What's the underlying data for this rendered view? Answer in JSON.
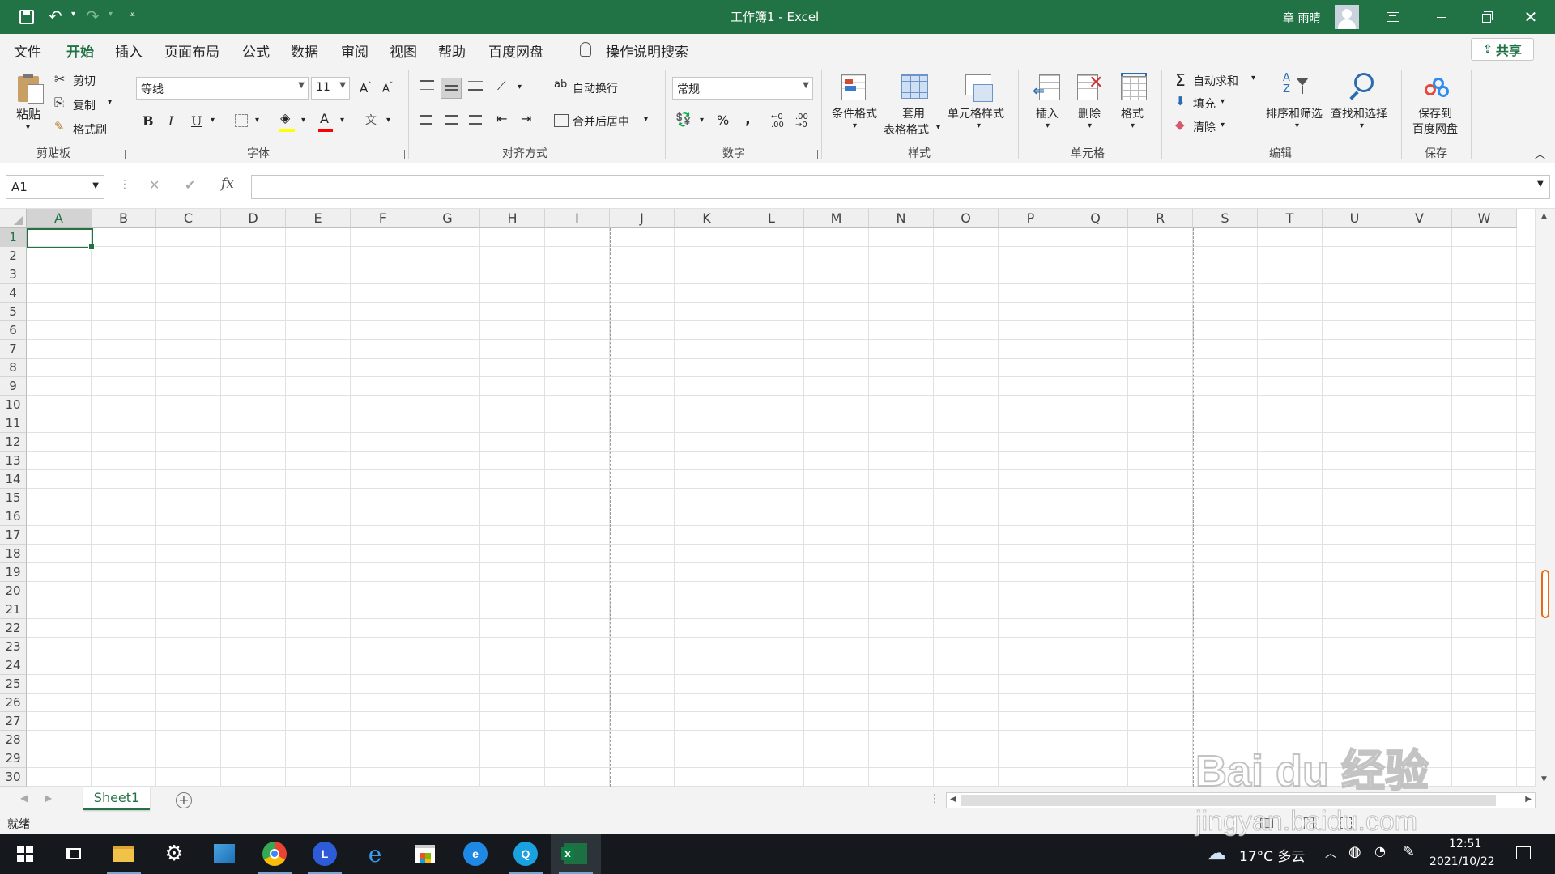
{
  "title_bar": {
    "title": "工作簿1  -  Excel",
    "user": "章 雨晴"
  },
  "menu": {
    "tabs": [
      "文件",
      "开始",
      "插入",
      "页面布局",
      "公式",
      "数据",
      "审阅",
      "视图",
      "帮助",
      "百度网盘"
    ],
    "search": "操作说明搜索",
    "share": "共享"
  },
  "ribbon": {
    "clipboard": {
      "paste": "粘贴",
      "cut": "剪切",
      "copy": "复制",
      "format_painter": "格式刷",
      "label": "剪贴板"
    },
    "font": {
      "name": "等线",
      "size": "11",
      "bold": "B",
      "italic": "I",
      "underline": "U",
      "label": "字体"
    },
    "alignment": {
      "wrap": "自动换行",
      "merge": "合并后居中",
      "label": "对齐方式"
    },
    "number": {
      "format": "常规",
      "percent": "%",
      "comma": ",",
      "label": "数字"
    },
    "styles": {
      "conditional": "条件格式",
      "table_line1": "套用",
      "table_line2": "表格格式",
      "cell_styles": "单元格样式",
      "label": "样式"
    },
    "cells": {
      "insert": "插入",
      "delete": "删除",
      "format": "格式",
      "label": "单元格"
    },
    "editing": {
      "autosum": "自动求和",
      "fill": "填充",
      "clear": "清除",
      "sort": "排序和筛选",
      "find": "查找和选择",
      "label": "编辑"
    },
    "save": {
      "line1": "保存到",
      "line2": "百度网盘",
      "label": "保存"
    }
  },
  "formula_bar": {
    "name_box": "A1",
    "fx": "fx",
    "value": ""
  },
  "columns": [
    "A",
    "B",
    "C",
    "D",
    "E",
    "F",
    "G",
    "H",
    "I",
    "J",
    "K",
    "L",
    "M",
    "N",
    "O",
    "P",
    "Q",
    "R",
    "S",
    "T",
    "U",
    "V",
    "W"
  ],
  "rows": [
    "1",
    "2",
    "3",
    "4",
    "5",
    "6",
    "7",
    "8",
    "9",
    "10",
    "11",
    "12",
    "13",
    "14",
    "15",
    "16",
    "17",
    "18",
    "19",
    "20",
    "21",
    "22",
    "23",
    "24",
    "25",
    "26",
    "27",
    "28",
    "29",
    "30"
  ],
  "sheet": {
    "tab": "Sheet1"
  },
  "status": {
    "ready": "就绪"
  },
  "taskbar": {
    "weather": "17°C 多云",
    "time": "12:51",
    "date": "2021/10/22"
  },
  "watermark": {
    "logo": "Bai du 经验",
    "url": "jingyan.baidu.com"
  },
  "colors": {
    "accent": "#217346",
    "taskbar": "#15191d"
  }
}
